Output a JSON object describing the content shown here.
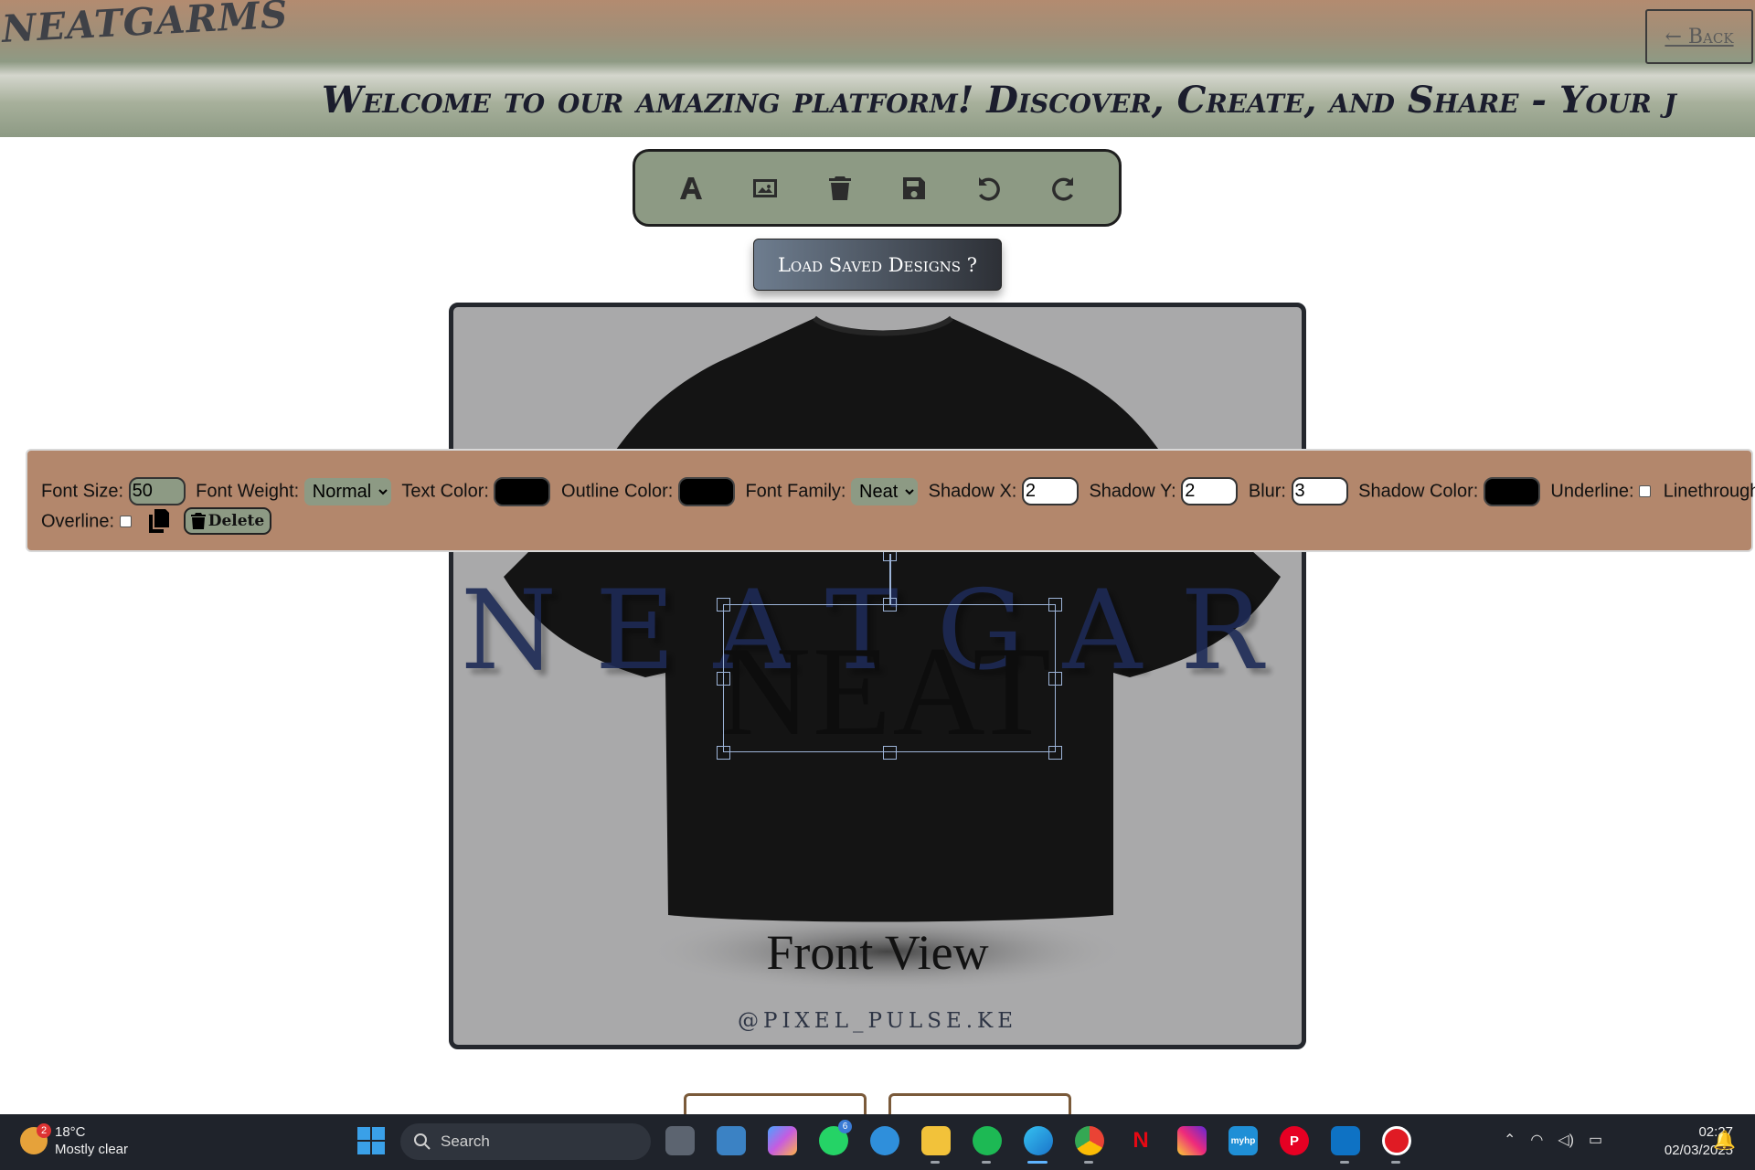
{
  "header": {
    "logo": "NEATGARMS",
    "back_label": "← Back",
    "marquee": "Welcome to our amazing platform! Discover, Create, and Share - Your j"
  },
  "toolbar": {
    "tools": [
      "text-tool-icon",
      "image-tool-icon",
      "trash-icon",
      "save-icon",
      "undo-icon",
      "redo-icon"
    ]
  },
  "load_button": "Load Saved Designs ?",
  "canvas": {
    "background_text": "NEATGARMS",
    "selected_text": "NEAT",
    "view_label": "Front View",
    "watermark": "@PIXEL_PULSE.KE"
  },
  "properties": {
    "font_size_label": "Font Size:",
    "font_size_value": "50",
    "font_weight_label": "Font Weight:",
    "font_weight_value": "Normal",
    "text_color_label": "Text Color:",
    "outline_color_label": "Outline Color:",
    "font_family_label": "Font Family:",
    "font_family_value": "Neat",
    "shadow_x_label": "Shadow X:",
    "shadow_x_value": "2",
    "shadow_y_label": "Shadow Y:",
    "shadow_y_value": "2",
    "blur_label": "Blur:",
    "blur_value": "3",
    "shadow_color_label": "Shadow Color:",
    "underline_label": "Underline:",
    "linethrough_label": "Linethrough:",
    "overline_label": "Overline:",
    "delete_label": "Delete",
    "text_color": "#000000",
    "outline_color": "#000000",
    "shadow_color": "#000000"
  },
  "taskbar": {
    "weather_temp": "18°C",
    "weather_desc": "Mostly clear",
    "weather_badge": "2",
    "search_placeholder": "Search",
    "whatsapp_badge": "6",
    "time": "02:27",
    "date": "02/03/2025"
  },
  "colors": {
    "accent_green": "#8d9a84",
    "panel_brown": "#b3876c",
    "header_brown": "#b38b70"
  }
}
